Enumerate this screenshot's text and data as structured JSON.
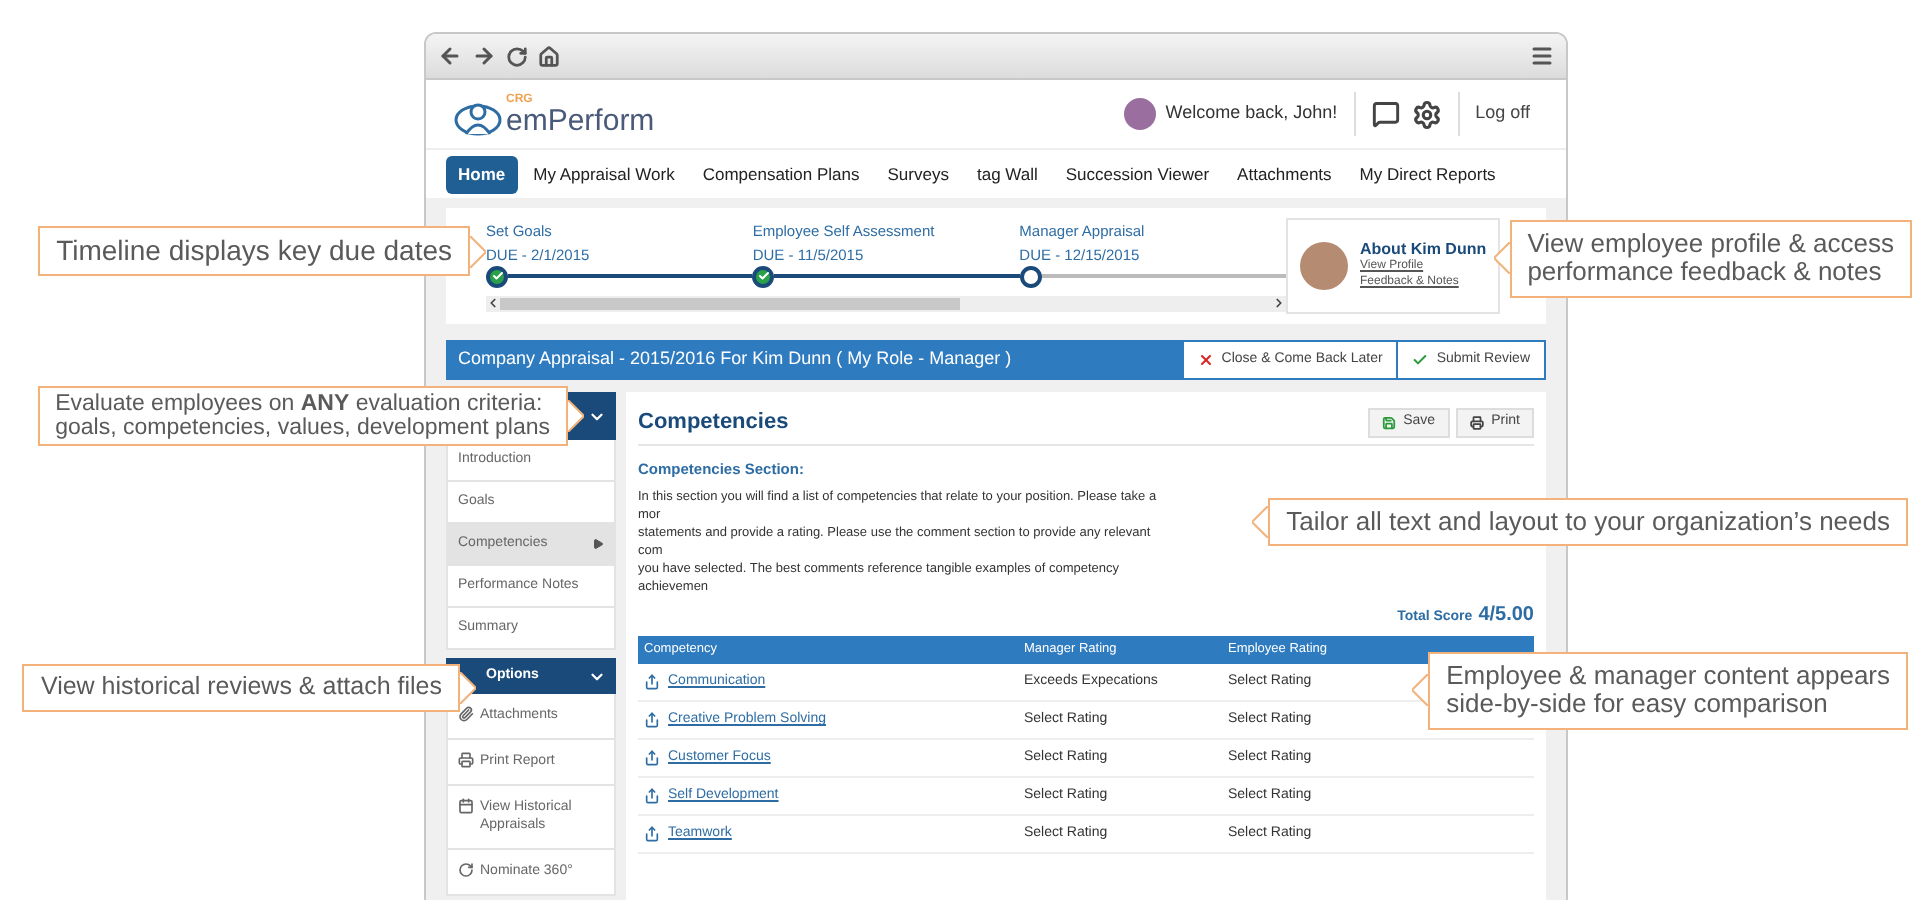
{
  "header": {
    "logo": {
      "tag": "CRG",
      "name": "emPerform"
    },
    "welcome": "Welcome back, John!",
    "logoff": "Log off"
  },
  "nav": [
    {
      "label": "Home",
      "selected": true
    },
    {
      "label": "My Appraisal Work",
      "selected": false
    },
    {
      "label": "Compensation Plans",
      "selected": false
    },
    {
      "label": "Surveys",
      "selected": false
    },
    {
      "label": "tag Wall",
      "selected": false
    },
    {
      "label": "Succession Viewer",
      "selected": false
    },
    {
      "label": "Attachments",
      "selected": false
    },
    {
      "label": "My Direct Reports",
      "selected": false
    }
  ],
  "timeline": {
    "steps": [
      {
        "title": "Set Goals",
        "due": "DUE - 2/1/2015",
        "done": true
      },
      {
        "title": "Employee Self Assessment",
        "due": "DUE - 11/5/2015",
        "done": true
      },
      {
        "title": "Manager Appraisal",
        "due": "DUE - 12/15/2015",
        "done": false
      }
    ]
  },
  "profile": {
    "title": "About Kim Dunn",
    "links": [
      "View Profile",
      "Feedback & Notes"
    ]
  },
  "appraisal_bar": {
    "title": "Company Appraisal - 2015/2016 For Kim Dunn ( My Role - Manager )",
    "buttons": [
      {
        "label": "Close & Come Back Later",
        "kind": "close"
      },
      {
        "label": "Submit Review",
        "kind": "submit"
      }
    ]
  },
  "sidebar": {
    "items": [
      {
        "label": "Introduction",
        "selected": false
      },
      {
        "label": "Goals",
        "selected": false
      },
      {
        "label": "Competencies",
        "selected": true
      },
      {
        "label": "Performance Notes",
        "selected": false
      },
      {
        "label": "Summary",
        "selected": false
      }
    ],
    "options": {
      "title": "Options",
      "items": [
        {
          "label": "Attachments",
          "kind": "attach"
        },
        {
          "label": "Print Report",
          "kind": "print"
        },
        {
          "label": "View Historical Appraisals",
          "kind": "history"
        },
        {
          "label": "Nominate 360°",
          "kind": "nominate"
        }
      ]
    }
  },
  "main": {
    "title": "Competencies",
    "actions": [
      {
        "label": "Save",
        "kind": "save"
      },
      {
        "label": "Print",
        "kind": "print"
      }
    ],
    "section_title": "Competencies Section:",
    "paragraph_lines": [
      "In this section you will find a list of competencies that relate to your position. Please take a mor",
      "statements and provide a rating. Please use the comment section to provide any relevant com",
      "you have selected. The best comments reference tangible examples of competency achievemen"
    ],
    "total_score": {
      "label": "Total Score",
      "value": "4/5.00"
    },
    "table": {
      "columns": [
        "Competency",
        "Manager Rating",
        "Employee Rating"
      ],
      "rows": [
        {
          "competency": "Communication",
          "manager_rating": "Exceeds Expecations",
          "employee_rating": "Select Rating"
        },
        {
          "competency": "Creative Problem Solving",
          "manager_rating": "Select Rating",
          "employee_rating": "Select Rating"
        },
        {
          "competency": "Customer Focus",
          "manager_rating": "Select Rating",
          "employee_rating": "Select Rating"
        },
        {
          "competency": "Self Development",
          "manager_rating": "Select Rating",
          "employee_rating": "Select Rating"
        },
        {
          "competency": "Teamwork",
          "manager_rating": "Select Rating",
          "employee_rating": "Select Rating"
        }
      ]
    }
  },
  "callouts": [
    {
      "text": "Timeline displays key due dates"
    },
    {
      "text": "Evaluate employees on **ANY** evaluation criteria:\ngoals, competencies, values, development plans"
    },
    {
      "text": "Tailor all text and layout to your organization’s needs"
    },
    {
      "text": "View historical reviews & attach files"
    },
    {
      "text": "View employee profile & access\nperformance feedback & notes"
    },
    {
      "text": "Employee & manager content appears\nside-by-side for easy comparison"
    }
  ]
}
